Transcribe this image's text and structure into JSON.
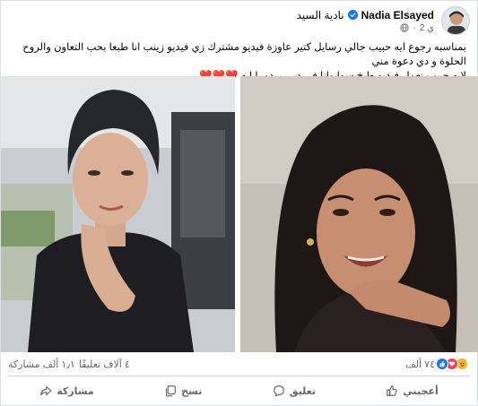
{
  "post": {
    "author_name": "Nadia Elsayed",
    "author_name_ar": "نادية السيد",
    "time": "2 ي",
    "separator": "·",
    "text_line1": "بمناسبه رجوع ايه حبيب جالي رسايل كتير عاوزة فيديو مشترك زي فيديو زينب انا طبعا بحب التعاون والروح الحلوة و دي دعوة مني",
    "text_line2": "لايه حبيب نعمل فيديو طبخ سوا وانا في دبي بردو يا ايه",
    "hearts": "❤️❤️❤️"
  },
  "stats": {
    "reactions_count": "٧٤ ألف",
    "comments": "٤ آلاف تعليقًا",
    "shares": "١٫١ ألف مشاركة"
  },
  "actions": {
    "like": "أعجبني",
    "comment": "تعليق",
    "copy": "نسخ",
    "share": "مشاركة"
  },
  "colors": {
    "like_blue": "#1877f2",
    "love_red": "#f33e58",
    "haha_yellow": "#f7b125",
    "verified_blue": "#1877f2"
  }
}
